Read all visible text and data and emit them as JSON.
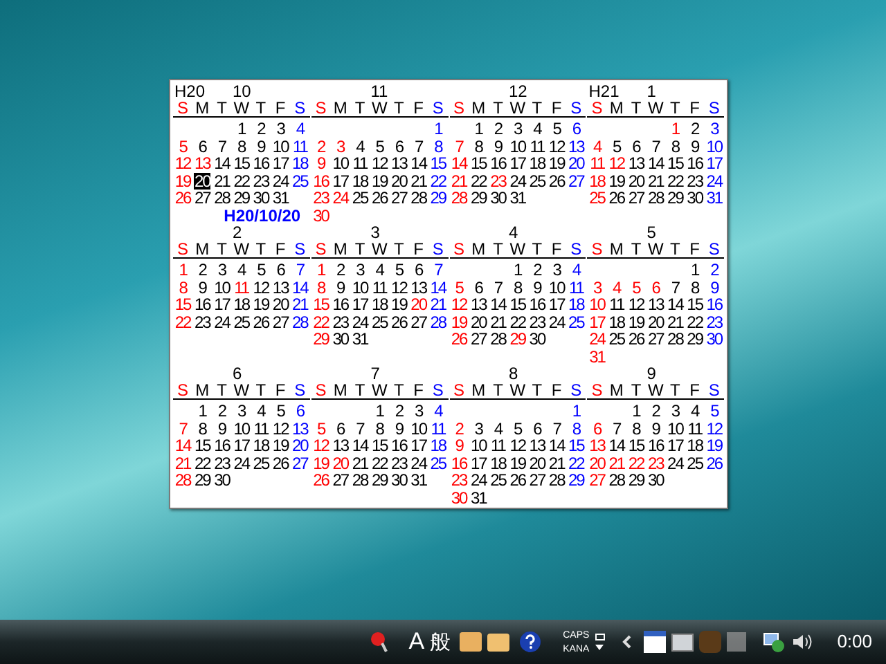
{
  "calendar": {
    "today_label": "H20/10/20",
    "months": [
      {
        "era": "H20",
        "month": "10",
        "weekdays": [
          "S",
          "M",
          "T",
          "W",
          "T",
          "F",
          "S"
        ],
        "weeks": [
          [
            "1",
            "2",
            "3",
            "4"
          ],
          [
            "5",
            "6",
            "7",
            "8",
            "9",
            "10",
            "11"
          ],
          [
            "12",
            {
              "day": "13",
              "kind": "holiday"
            },
            "14",
            "15",
            "16",
            "17",
            "18"
          ],
          [
            "19",
            {
              "day": "20",
              "kind": "today"
            },
            "21",
            "22",
            "23",
            "24",
            "25"
          ],
          [
            "26",
            "27",
            "28",
            "29",
            "30",
            "31"
          ]
        ]
      },
      {
        "month": "11",
        "weekdays": [
          "S",
          "M",
          "T",
          "W",
          "T",
          "F",
          "S"
        ],
        "weeks": [
          [
            "1"
          ],
          [
            "2",
            {
              "day": "3",
              "kind": "holiday"
            },
            "4",
            "5",
            "6",
            "7",
            "8"
          ],
          [
            "9",
            "10",
            "11",
            "12",
            "13",
            "14",
            "15"
          ],
          [
            "16",
            "17",
            "18",
            "19",
            "20",
            "21",
            "22"
          ],
          [
            "23",
            {
              "day": "24",
              "kind": "holiday"
            },
            "25",
            "26",
            "27",
            "28",
            "29"
          ],
          [
            "30"
          ]
        ]
      },
      {
        "month": "12",
        "weekdays": [
          "S",
          "M",
          "T",
          "W",
          "T",
          "F",
          "S"
        ],
        "weeks": [
          [
            "1",
            "2",
            "3",
            "4",
            "5",
            "6"
          ],
          [
            "7",
            "8",
            "9",
            "10",
            "11",
            "12",
            "13"
          ],
          [
            "14",
            "15",
            "16",
            "17",
            "18",
            "19",
            "20"
          ],
          [
            "21",
            "22",
            {
              "day": "23",
              "kind": "holiday"
            },
            "24",
            "25",
            "26",
            "27"
          ],
          [
            "28",
            "29",
            "30",
            "31"
          ]
        ]
      },
      {
        "era": "H21",
        "month": "1",
        "weekdays": [
          "S",
          "M",
          "T",
          "W",
          "T",
          "F",
          "S"
        ],
        "weeks": [
          [
            {
              "day": "1",
              "kind": "holiday"
            },
            "2",
            "3"
          ],
          [
            "4",
            "5",
            "6",
            "7",
            "8",
            "9",
            "10"
          ],
          [
            "11",
            {
              "day": "12",
              "kind": "holiday"
            },
            "13",
            "14",
            "15",
            "16",
            "17"
          ],
          [
            "18",
            "19",
            "20",
            "21",
            "22",
            "23",
            "24"
          ],
          [
            "25",
            "26",
            "27",
            "28",
            "29",
            "30",
            "31"
          ]
        ]
      },
      {
        "month": "2",
        "weekdays": [
          "S",
          "M",
          "T",
          "W",
          "T",
          "F",
          "S"
        ],
        "weeks": [
          [
            "1",
            "2",
            "3",
            "4",
            "5",
            "6",
            "7"
          ],
          [
            "8",
            "9",
            "10",
            {
              "day": "11",
              "kind": "holiday"
            },
            "12",
            "13",
            "14"
          ],
          [
            "15",
            "16",
            "17",
            "18",
            "19",
            "20",
            "21"
          ],
          [
            "22",
            "23",
            "24",
            "25",
            "26",
            "27",
            "28"
          ]
        ]
      },
      {
        "month": "3",
        "weekdays": [
          "S",
          "M",
          "T",
          "W",
          "T",
          "F",
          "S"
        ],
        "weeks": [
          [
            "1",
            "2",
            "3",
            "4",
            "5",
            "6",
            "7"
          ],
          [
            "8",
            "9",
            "10",
            "11",
            "12",
            "13",
            "14"
          ],
          [
            "15",
            "16",
            "17",
            "18",
            "19",
            {
              "day": "20",
              "kind": "holiday"
            },
            "21"
          ],
          [
            "22",
            "23",
            "24",
            "25",
            "26",
            "27",
            "28"
          ],
          [
            "29",
            "30",
            "31"
          ]
        ]
      },
      {
        "month": "4",
        "weekdays": [
          "S",
          "M",
          "T",
          "W",
          "T",
          "F",
          "S"
        ],
        "weeks": [
          [
            "1",
            "2",
            "3",
            "4"
          ],
          [
            "5",
            "6",
            "7",
            "8",
            "9",
            "10",
            "11"
          ],
          [
            "12",
            "13",
            "14",
            "15",
            "16",
            "17",
            "18"
          ],
          [
            "19",
            "20",
            "21",
            "22",
            "23",
            "24",
            "25"
          ],
          [
            "26",
            "27",
            "28",
            {
              "day": "29",
              "kind": "holiday"
            },
            "30"
          ]
        ]
      },
      {
        "month": "5",
        "weekdays": [
          "S",
          "M",
          "T",
          "W",
          "T",
          "F",
          "S"
        ],
        "weeks": [
          [
            "1",
            "2"
          ],
          [
            "3",
            {
              "day": "4",
              "kind": "holiday"
            },
            {
              "day": "5",
              "kind": "holiday"
            },
            {
              "day": "6",
              "kind": "holiday"
            },
            "7",
            "8",
            "9"
          ],
          [
            "10",
            "11",
            "12",
            "13",
            "14",
            "15",
            "16"
          ],
          [
            "17",
            "18",
            "19",
            "20",
            "21",
            "22",
            "23"
          ],
          [
            "24",
            "25",
            "26",
            "27",
            "28",
            "29",
            "30"
          ],
          [
            "31"
          ]
        ]
      },
      {
        "month": "6",
        "weekdays": [
          "S",
          "M",
          "T",
          "W",
          "T",
          "F",
          "S"
        ],
        "weeks": [
          [
            "1",
            "2",
            "3",
            "4",
            "5",
            "6"
          ],
          [
            "7",
            "8",
            "9",
            "10",
            "11",
            "12",
            "13"
          ],
          [
            "14",
            "15",
            "16",
            "17",
            "18",
            "19",
            "20"
          ],
          [
            "21",
            "22",
            "23",
            "24",
            "25",
            "26",
            "27"
          ],
          [
            "28",
            "29",
            "30"
          ]
        ]
      },
      {
        "month": "7",
        "weekdays": [
          "S",
          "M",
          "T",
          "W",
          "T",
          "F",
          "S"
        ],
        "weeks": [
          [
            "1",
            "2",
            "3",
            "4"
          ],
          [
            "5",
            "6",
            "7",
            "8",
            "9",
            "10",
            "11"
          ],
          [
            "12",
            "13",
            "14",
            "15",
            "16",
            "17",
            "18"
          ],
          [
            "19",
            {
              "day": "20",
              "kind": "holiday"
            },
            "21",
            "22",
            "23",
            "24",
            "25"
          ],
          [
            "26",
            "27",
            "28",
            "29",
            "30",
            "31"
          ]
        ]
      },
      {
        "month": "8",
        "weekdays": [
          "S",
          "M",
          "T",
          "W",
          "T",
          "F",
          "S"
        ],
        "weeks": [
          [
            "1"
          ],
          [
            "2",
            "3",
            "4",
            "5",
            "6",
            "7",
            "8"
          ],
          [
            "9",
            "10",
            "11",
            "12",
            "13",
            "14",
            "15"
          ],
          [
            "16",
            "17",
            "18",
            "19",
            "20",
            "21",
            "22"
          ],
          [
            "23",
            "24",
            "25",
            "26",
            "27",
            "28",
            "29"
          ],
          [
            "30",
            "31"
          ]
        ]
      },
      {
        "month": "9",
        "weekdays": [
          "S",
          "M",
          "T",
          "W",
          "T",
          "F",
          "S"
        ],
        "weeks": [
          [
            "1",
            "2",
            "3",
            "4",
            "5"
          ],
          [
            "6",
            "7",
            "8",
            "9",
            "10",
            "11",
            "12"
          ],
          [
            "13",
            "14",
            "15",
            "16",
            "17",
            "18",
            "19"
          ],
          [
            "20",
            {
              "day": "21",
              "kind": "holiday"
            },
            {
              "day": "22",
              "kind": "holiday"
            },
            {
              "day": "23",
              "kind": "holiday"
            },
            "24",
            "25",
            "26"
          ],
          [
            "27",
            "28",
            "29",
            "30"
          ]
        ]
      }
    ]
  },
  "taskbar": {
    "ime_mode": "A",
    "ime_kind": "般",
    "caps": "CAPS",
    "kana": "KANA",
    "clock": "0:00"
  }
}
